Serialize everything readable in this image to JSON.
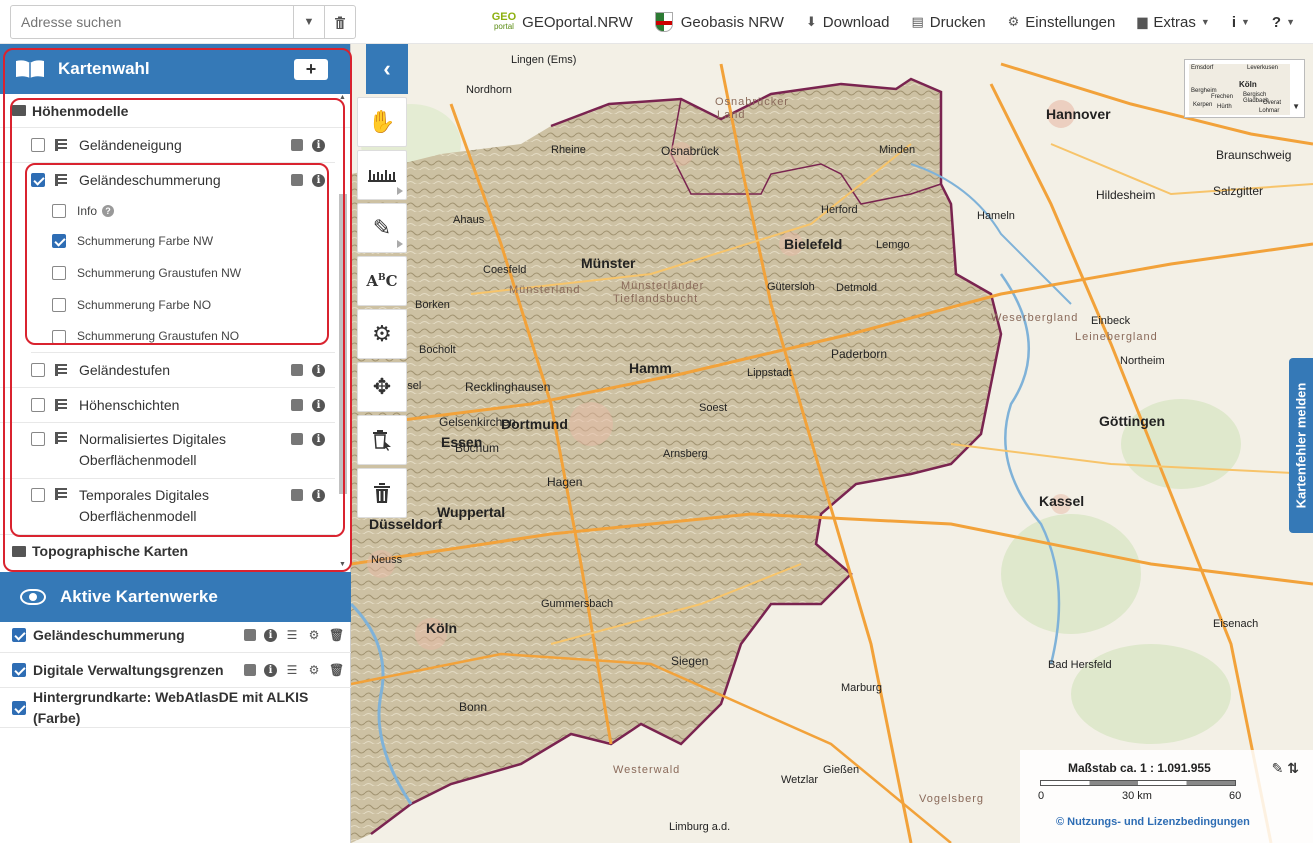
{
  "search": {
    "placeholder": "Adresse suchen"
  },
  "topnav": {
    "geo_line1": "GEO",
    "geo_line2": "portal",
    "geoportal": "GEOportal.NRW",
    "geobasis": "Geobasis NRW",
    "download": "Download",
    "drucken": "Drucken",
    "einstellungen": "Einstellungen",
    "extras": "Extras",
    "info": "i",
    "help": "?"
  },
  "kartenwahl": {
    "title": "Kartenwahl",
    "add": "+",
    "collapse": "‹",
    "group": "Höhenmodelle",
    "layers": [
      {
        "label": "Geländeneigung",
        "checked": false
      },
      {
        "label": "Geländeschummerung",
        "checked": true
      },
      {
        "label": "Geländestufen",
        "checked": false
      },
      {
        "label": "Höhenschichten",
        "checked": false
      },
      {
        "label_1": "Normalisiertes Digitales",
        "label_2": "Oberflächenmodell",
        "checked": false
      },
      {
        "label_1": "Temporales Digitales",
        "label_2": "Oberflächenmodell",
        "checked": false
      }
    ],
    "sub": [
      {
        "label": "Info",
        "checked": false
      },
      {
        "label": "Schummerung Farbe NW",
        "checked": true
      },
      {
        "label": "Schummerung Graustufen NW",
        "checked": false
      },
      {
        "label": "Schummerung Farbe NO",
        "checked": false
      },
      {
        "label": "Schummerung Graustufen NO",
        "checked": false
      }
    ],
    "group2": "Topographische Karten"
  },
  "aktive": {
    "title": "Aktive Kartenwerke",
    "items": [
      {
        "label": "Geländeschummerung"
      },
      {
        "label": "Digitale Verwaltungsgrenzen"
      },
      {
        "label": "Hintergrundkarte: WebAtlasDE mit ALKIS (Farbe)"
      }
    ]
  },
  "map": {
    "labels": {
      "hannover": "Hannover",
      "osnabrueck": "Osnabrück",
      "bielefeld": "Bielefeld",
      "muenster": "Münster",
      "dortmund": "Dortmund",
      "essen": "Essen",
      "duesseldorf": "Düsseldorf",
      "koeln": "Köln",
      "kassel": "Kassel",
      "goettingen": "Göttingen",
      "paderborn": "Paderborn",
      "hamm": "Hamm",
      "hildesheim": "Hildesheim",
      "braunschweig": "Braunschweig",
      "salzgitter": "Salzgitter",
      "wuppertal": "Wuppertal",
      "bochum": "Bochum",
      "siegen": "Siegen",
      "marburg": "Marburg",
      "giessen": "Gießen",
      "lingen": "Lingen (Ems)",
      "nordhorn": "Nordhorn",
      "minden": "Minden",
      "gelsenkirchen": "Gelsenkirchen",
      "hameln": "Hameln",
      "recklinghausen": "Recklinghausen",
      "lippstadt": "Lippstadt",
      "soest": "Soest",
      "arnsberg": "Arnsberg",
      "gummersbach": "Gummersbach",
      "bonn": "Bonn",
      "neuss": "Neuss",
      "bad_hersfeld": "Bad Hersfeld",
      "wetzlar": "Wetzlar",
      "limburg": "Limburg a.d.",
      "eisenach": "Eisenach",
      "detmold": "Detmold",
      "hagen": "Hagen",
      "guetersloh": "Gütersloh",
      "herford": "Herford",
      "rheine": "Rheine",
      "bocholt": "Bocholt",
      "ahaus": "Ahaus",
      "coesfeld": "Coesfeld",
      "borken": "Borken",
      "wesel": "Wesel",
      "lemgo": "Lemgo",
      "northeim": "Northeim",
      "einbeck": "Einbeck",
      "reg1": "Münsterländer",
      "reg2": "Tieflandsbucht",
      "reg3": "Münsterland",
      "reg4": "Osnabrücker",
      "reg5": "Land",
      "reg6": "Westerwald",
      "reg7": "Vogelsberg",
      "reg8": "Weserbergland",
      "reg9": "Leinebergland"
    }
  },
  "minimap": {
    "labels": [
      "Emsdorf",
      "Leverkusen",
      "Köln",
      "Bergheim",
      "Frechen",
      "Bergisch Gladbach",
      "Kerpen",
      "Hürth",
      "Overat",
      "Lohmar"
    ]
  },
  "sidetab": "Kartenfehler melden",
  "scale": {
    "title": "Maßstab ca. 1 : 1.091.955",
    "t0": "0",
    "t1": "30 km",
    "t2": "60",
    "license": "© Nutzungs- und Lizenzbedingungen"
  },
  "colors": {
    "accent": "#3579b7",
    "highlight": "#d9232f",
    "nrw_border": "#7a2450"
  }
}
